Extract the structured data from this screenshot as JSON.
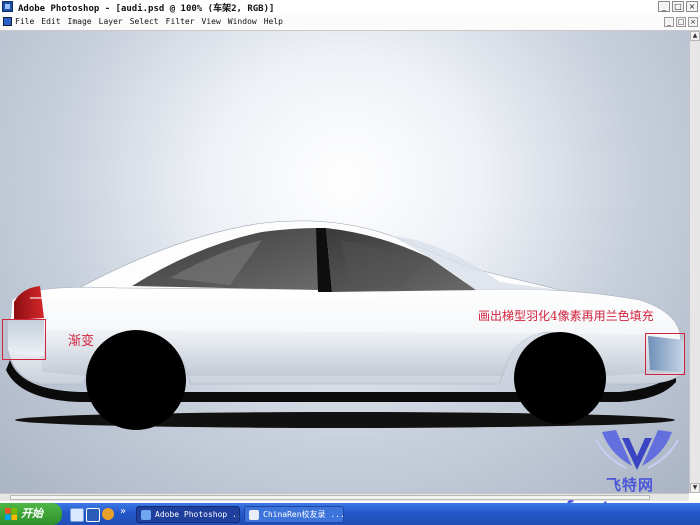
{
  "window": {
    "title": "Adobe Photoshop - [audi.psd @ 100% (车架2, RGB)]",
    "controls": [
      "_",
      "□",
      "×"
    ]
  },
  "menu": {
    "items": [
      "File",
      "Edit",
      "Image",
      "Layer",
      "Select",
      "Filter",
      "View",
      "Window",
      "Help"
    ],
    "doc_controls": [
      "_",
      "□",
      "×"
    ]
  },
  "annotations": {
    "left_label": "渐变",
    "right_label": "画出梯型羽化4像素再用兰色填充"
  },
  "taskbar": {
    "start_label": "开始",
    "tasks": [
      {
        "label": "Adobe Photoshop ...",
        "active": true
      },
      {
        "label": "ChinaRen校友录 ...",
        "active": false
      }
    ],
    "more": "»"
  },
  "watermark": {
    "line1": "飞特网",
    "line2": "fevte.com"
  },
  "colors": {
    "annotation": "#d2233e",
    "taskbar": "#2457c9",
    "start_button": "#3aa336",
    "watermark": "#4b57d8"
  }
}
